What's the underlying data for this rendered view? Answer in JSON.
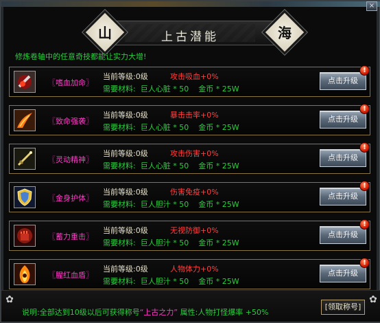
{
  "title": "上古潜能",
  "title_left_char": "山",
  "title_right_char": "海",
  "close_glyph": "×",
  "intro": "修炼卷轴中的任意奇技都能让实力大增!",
  "upgrade_label": "点击升级",
  "alert_glyph": "!",
  "skills": [
    {
      "name": "〖嗜血加命〗",
      "level_label": "当前等级:",
      "level": "0级",
      "effect": "攻击吸血+0%",
      "material_label": "需要材料:",
      "material": "巨人心脏",
      "material_qty": "* 50",
      "coin_label": "金币",
      "coin_qty": "* 25W",
      "icon": "blood-axe-icon"
    },
    {
      "name": "〖致命强袭〗",
      "level_label": "当前等级:",
      "level": "0级",
      "effect": "暴击击率+0%",
      "material_label": "需要材料:",
      "material": "巨人心脏",
      "material_qty": "* 50",
      "coin_label": "金币",
      "coin_qty": "* 25W",
      "icon": "fire-slash-icon"
    },
    {
      "name": "〖灵动精神〗",
      "level_label": "当前等级:",
      "level": "0级",
      "effect": "攻击伤害+0%",
      "material_label": "需要材料:",
      "material": "巨人心脏",
      "material_qty": "* 50",
      "coin_label": "金币",
      "coin_qty": "* 25W",
      "icon": "sword-icon"
    },
    {
      "name": "〖金身护体〗",
      "level_label": "当前等级:",
      "level": "0级",
      "effect": "伤害免疫+0%",
      "material_label": "需要材料:",
      "material": "巨人胆汁",
      "material_qty": "* 50",
      "coin_label": "金币",
      "coin_qty": "* 25W",
      "icon": "shield-icon"
    },
    {
      "name": "〖蓄力重击〗",
      "level_label": "当前等级:",
      "level": "0级",
      "effect": "无视防御+0%",
      "material_label": "需要材料:",
      "material": "巨人胆汁",
      "material_qty": "* 50",
      "coin_label": "金币",
      "coin_qty": "* 25W",
      "icon": "fist-icon"
    },
    {
      "name": "〖腥红血盾〗",
      "level_label": "当前等级:",
      "level": "0级",
      "effect": "人物体力+0%",
      "material_label": "需要材料:",
      "material": "巨人胆汁",
      "material_qty": "* 50",
      "coin_label": "金币",
      "coin_qty": "* 25W",
      "icon": "flame-figure-icon"
    }
  ],
  "footer": {
    "prefix": "说明:全部达到10级以后可获得称号",
    "title_name": "“上古之力”",
    "suffix": " 属性:人物打怪爆率 +50%",
    "claim_label": "[领取称号]"
  },
  "colors": {
    "green": "#2ecc40",
    "pink": "#ff3cc8",
    "red": "#ff4040",
    "gold_border": "#8a7440"
  }
}
